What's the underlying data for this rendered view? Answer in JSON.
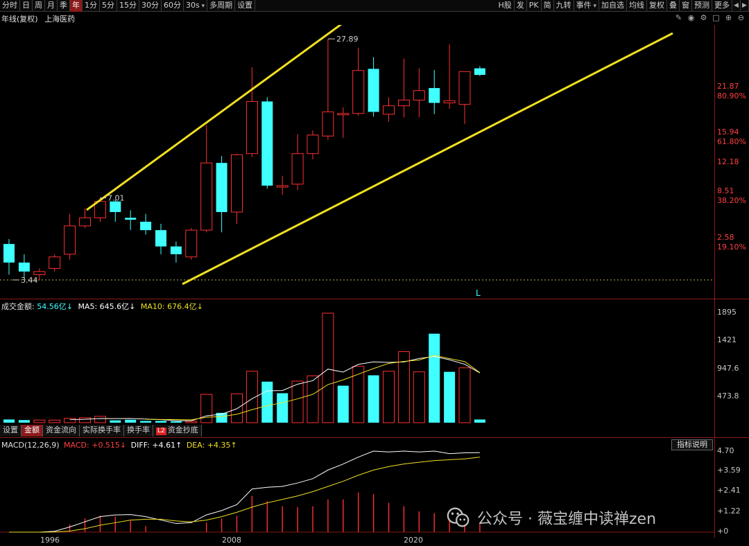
{
  "toolbar": {
    "left": [
      {
        "label": "分时",
        "active": false,
        "dd": false
      },
      {
        "label": "日",
        "active": false,
        "dd": false
      },
      {
        "label": "周",
        "active": false,
        "dd": false
      },
      {
        "label": "月",
        "active": false,
        "dd": false
      },
      {
        "label": "季",
        "active": false,
        "dd": false
      },
      {
        "label": "年",
        "active": true,
        "dd": false
      },
      {
        "label": "1分",
        "active": false,
        "dd": false
      },
      {
        "label": "5分",
        "active": false,
        "dd": false
      },
      {
        "label": "15分",
        "active": false,
        "dd": false
      },
      {
        "label": "30分",
        "active": false,
        "dd": false
      },
      {
        "label": "60分",
        "active": false,
        "dd": false
      },
      {
        "label": "30s",
        "active": false,
        "dd": true
      },
      {
        "label": "多周期",
        "active": false,
        "dd": false
      },
      {
        "label": "设置",
        "active": false,
        "dd": false
      }
    ],
    "right": [
      {
        "label": "H股",
        "dd": false
      },
      {
        "label": "发",
        "dd": false
      },
      {
        "label": "PK",
        "dd": false
      },
      {
        "label": "简",
        "dd": false
      },
      {
        "label": "九转",
        "dd": false
      },
      {
        "label": "事件",
        "dd": true
      },
      {
        "label": "加自选",
        "dd": false
      },
      {
        "label": "均线",
        "dd": false
      },
      {
        "label": "复权",
        "dd": false
      },
      {
        "label": "叠",
        "dd": false
      },
      {
        "label": "窗",
        "dd": false
      },
      {
        "label": "预测",
        "dd": false
      },
      {
        "label": "更多",
        "dd": false
      }
    ]
  },
  "header": {
    "period": "年线(复权)",
    "stock": "上海医药"
  },
  "tools": [
    "pencil-icon",
    "eye-icon",
    "settings-icon",
    "lock-icon",
    "plus-circle-icon",
    "minus-circle-icon"
  ],
  "price_axis": [
    {
      "text": "21.87",
      "color": "#ff4040"
    },
    {
      "text": "80.90%",
      "color": "#ff4040"
    },
    {
      "text": "15.94",
      "color": "#ff4040"
    },
    {
      "text": "61.80%",
      "color": "#ff4040"
    },
    {
      "text": "12.18",
      "color": "#ff4040"
    },
    {
      "text": "8.51",
      "color": "#ff4040"
    },
    {
      "text": "38.20%",
      "color": "#ff4040"
    },
    {
      "text": "2.58",
      "color": "#ff4040"
    },
    {
      "text": "19.10%",
      "color": "#ff4040"
    }
  ],
  "annotations": {
    "high": "27.89",
    "mid_high": "7.01",
    "low": "3.44",
    "marker": "L"
  },
  "volume": {
    "label": "成交金额:",
    "value": "54.56亿↓",
    "ma5": "MA5: 645.6亿↓",
    "ma10": "MA10: 676.4亿↓",
    "axis": [
      "1895",
      "1421",
      "947.6",
      "473.8"
    ]
  },
  "subtabs": [
    {
      "label": "设置",
      "active": false,
      "badge": ""
    },
    {
      "label": "金额",
      "active": true,
      "badge": ""
    },
    {
      "label": "资金流向",
      "active": false,
      "badge": ""
    },
    {
      "label": "实际换手率",
      "active": false,
      "badge": ""
    },
    {
      "label": "换手率",
      "active": false,
      "badge": ""
    },
    {
      "label": "资金抄底",
      "active": false,
      "badge": "L2"
    }
  ],
  "macd": {
    "name": "MACD(12,26,9)",
    "macd": "MACD: +0.515↓",
    "diff": "DIFF: +4.61↑",
    "dea": "DEA: +4.35↑",
    "axis": [
      "4.70",
      "+3.59",
      "+2.41",
      "+1.22",
      "+0"
    ],
    "explain": "指标说明"
  },
  "x_axis": [
    "1996",
    "2008",
    "2020"
  ],
  "watermark": "公众号 · 薇宝缠中读禅zen",
  "colors": {
    "up": "#ff3030",
    "down": "#40ffff",
    "trend": "#f0e020",
    "grid": "#8b1a1a",
    "ma10": "#f0e020"
  },
  "chart_data": [
    {
      "type": "candlestick",
      "title": "年线(复权) 上海医药",
      "x": [
        "1994",
        "1995",
        "1996",
        "1997",
        "1998",
        "1999",
        "2000",
        "2001",
        "2002",
        "2003",
        "2004",
        "2005",
        "2006",
        "2007",
        "2008",
        "2009",
        "2010",
        "2011",
        "2012",
        "2013",
        "2014",
        "2015",
        "2016",
        "2017",
        "2018",
        "2019",
        "2020",
        "2021",
        "2022",
        "2023",
        "2024",
        "2025"
      ],
      "ohlc": [
        [
          4.7,
          4.9,
          3.6,
          4.0
        ],
        [
          4.0,
          4.3,
          3.5,
          3.7
        ],
        [
          3.6,
          3.8,
          3.44,
          3.7
        ],
        [
          3.8,
          4.3,
          3.7,
          4.2
        ],
        [
          4.3,
          6.1,
          4.1,
          5.5
        ],
        [
          5.5,
          6.4,
          5.4,
          5.9
        ],
        [
          5.9,
          7.01,
          5.7,
          6.8
        ],
        [
          6.8,
          6.9,
          5.7,
          6.2
        ],
        [
          5.9,
          6.3,
          5.3,
          5.8
        ],
        [
          5.7,
          6.1,
          5.1,
          5.3
        ],
        [
          5.3,
          5.6,
          4.3,
          4.6
        ],
        [
          4.6,
          4.8,
          4.0,
          4.3
        ],
        [
          4.2,
          5.4,
          4.1,
          5.3
        ],
        [
          5.3,
          13.2,
          5.2,
          9.5
        ],
        [
          9.5,
          10.1,
          5.2,
          6.2
        ],
        [
          6.2,
          10.3,
          5.6,
          10.2
        ],
        [
          10.3,
          21.8,
          10.0,
          16.2
        ],
        [
          16.2,
          16.8,
          7.6,
          7.8
        ],
        [
          7.7,
          8.5,
          7.2,
          7.8
        ],
        [
          7.9,
          12.2,
          7.5,
          10.3
        ],
        [
          10.3,
          12.6,
          9.8,
          12.1
        ],
        [
          12.0,
          27.89,
          11.6,
          14.8
        ],
        [
          14.6,
          15.4,
          11.8,
          14.6
        ],
        [
          14.6,
          25.8,
          14.3,
          21.2
        ],
        [
          21.5,
          23.8,
          14.2,
          14.8
        ],
        [
          14.5,
          16.8,
          13.6,
          15.6
        ],
        [
          15.6,
          23.5,
          14.1,
          16.4
        ],
        [
          16.4,
          21.6,
          14.1,
          17.8
        ],
        [
          18.2,
          21.3,
          14.5,
          16.0
        ],
        [
          16.0,
          26.6,
          15.2,
          16.3
        ],
        [
          15.8,
          21.0,
          13.3,
          21.0
        ],
        [
          21.6,
          22.0,
          20.2,
          20.4
        ]
      ],
      "yaxis": [
        "21.87",
        "15.94",
        "12.18",
        "8.51",
        "2.58"
      ]
    },
    {
      "type": "bar",
      "title": "成交金额",
      "categories": [
        "1994",
        "1995",
        "1996",
        "1997",
        "1998",
        "1999",
        "2000",
        "2001",
        "2002",
        "2003",
        "2004",
        "2005",
        "2006",
        "2007",
        "2008",
        "2009",
        "2010",
        "2011",
        "2012",
        "2013",
        "2014",
        "2015",
        "2016",
        "2017",
        "2018",
        "2019",
        "2020",
        "2021",
        "2022",
        "2023",
        "2024",
        "2025"
      ],
      "values": [
        55,
        45,
        45,
        45,
        75,
        85,
        110,
        40,
        50,
        30,
        30,
        20,
        25,
        490,
        170,
        500,
        890,
        710,
        510,
        720,
        810,
        1895,
        640,
        975,
        820,
        890,
        1230,
        880,
        1540,
        880,
        950,
        54.56
      ],
      "direction": [
        "down",
        "down",
        "up",
        "up",
        "up",
        "up",
        "up",
        "down",
        "down",
        "down",
        "down",
        "down",
        "up",
        "up",
        "down",
        "up",
        "up",
        "down",
        "down",
        "up",
        "up",
        "up",
        "down",
        "up",
        "down",
        "up",
        "up",
        "up",
        "down",
        "down",
        "up",
        "down"
      ],
      "ma5": [
        null,
        null,
        null,
        null,
        53,
        59,
        72,
        71,
        72,
        63,
        52,
        36,
        31,
        119,
        147,
        241,
        415,
        552,
        556,
        666,
        728,
        927,
        876,
        1009,
        1053,
        1044,
        1051,
        1111,
        1147,
        1088,
        1011,
        862
      ],
      "ma10": [
        null,
        null,
        null,
        null,
        null,
        null,
        null,
        null,
        null,
        58,
        55,
        52,
        50,
        95,
        105,
        145,
        225,
        296,
        344,
        413,
        490,
        659,
        741,
        839,
        937,
        1026,
        1060,
        1084,
        1165,
        1109,
        1057,
        866
      ],
      "yaxis": [
        "1895",
        "1421",
        "947.6",
        "473.8"
      ]
    },
    {
      "type": "line",
      "title": "MACD(12,26,9)",
      "x": [
        "1994",
        "1995",
        "1996",
        "1997",
        "1998",
        "1999",
        "2000",
        "2001",
        "2002",
        "2003",
        "2004",
        "2005",
        "2006",
        "2007",
        "2008",
        "2009",
        "2010",
        "2011",
        "2012",
        "2013",
        "2014",
        "2015",
        "2016",
        "2017",
        "2018",
        "2019",
        "2020",
        "2021",
        "2022",
        "2023",
        "2024",
        "2025"
      ],
      "series": [
        {
          "name": "DIFF",
          "values": [
            0.0,
            0.0,
            0.0,
            0.05,
            0.3,
            0.6,
            0.9,
            1.0,
            1.02,
            0.9,
            0.7,
            0.5,
            0.55,
            1.0,
            1.25,
            1.6,
            2.5,
            2.6,
            2.65,
            2.85,
            3.1,
            3.6,
            3.95,
            4.35,
            4.7,
            4.65,
            4.7,
            4.65,
            4.7,
            4.55,
            4.6,
            4.61
          ]
        },
        {
          "name": "DEA",
          "values": [
            0.0,
            0.0,
            0.0,
            0.01,
            0.06,
            0.2,
            0.4,
            0.55,
            0.7,
            0.75,
            0.75,
            0.65,
            0.6,
            0.7,
            0.9,
            1.15,
            1.45,
            1.7,
            1.9,
            2.1,
            2.35,
            2.65,
            2.95,
            3.3,
            3.6,
            3.8,
            3.95,
            4.05,
            4.15,
            4.2,
            4.25,
            4.35
          ]
        },
        {
          "name": "MACD",
          "values": [
            0.0,
            0.0,
            0.0,
            0.06,
            0.45,
            0.8,
            0.95,
            0.9,
            0.65,
            0.35,
            0.0,
            0.0,
            0.0,
            0.55,
            0.8,
            0.95,
            2.1,
            1.8,
            1.5,
            1.45,
            1.5,
            1.9,
            1.9,
            2.3,
            2.2,
            1.7,
            1.5,
            1.2,
            1.1,
            0.7,
            0.7,
            0.515
          ]
        }
      ],
      "yaxis": [
        "4.70",
        "+3.59",
        "+2.41",
        "+1.22",
        "+0"
      ]
    }
  ]
}
